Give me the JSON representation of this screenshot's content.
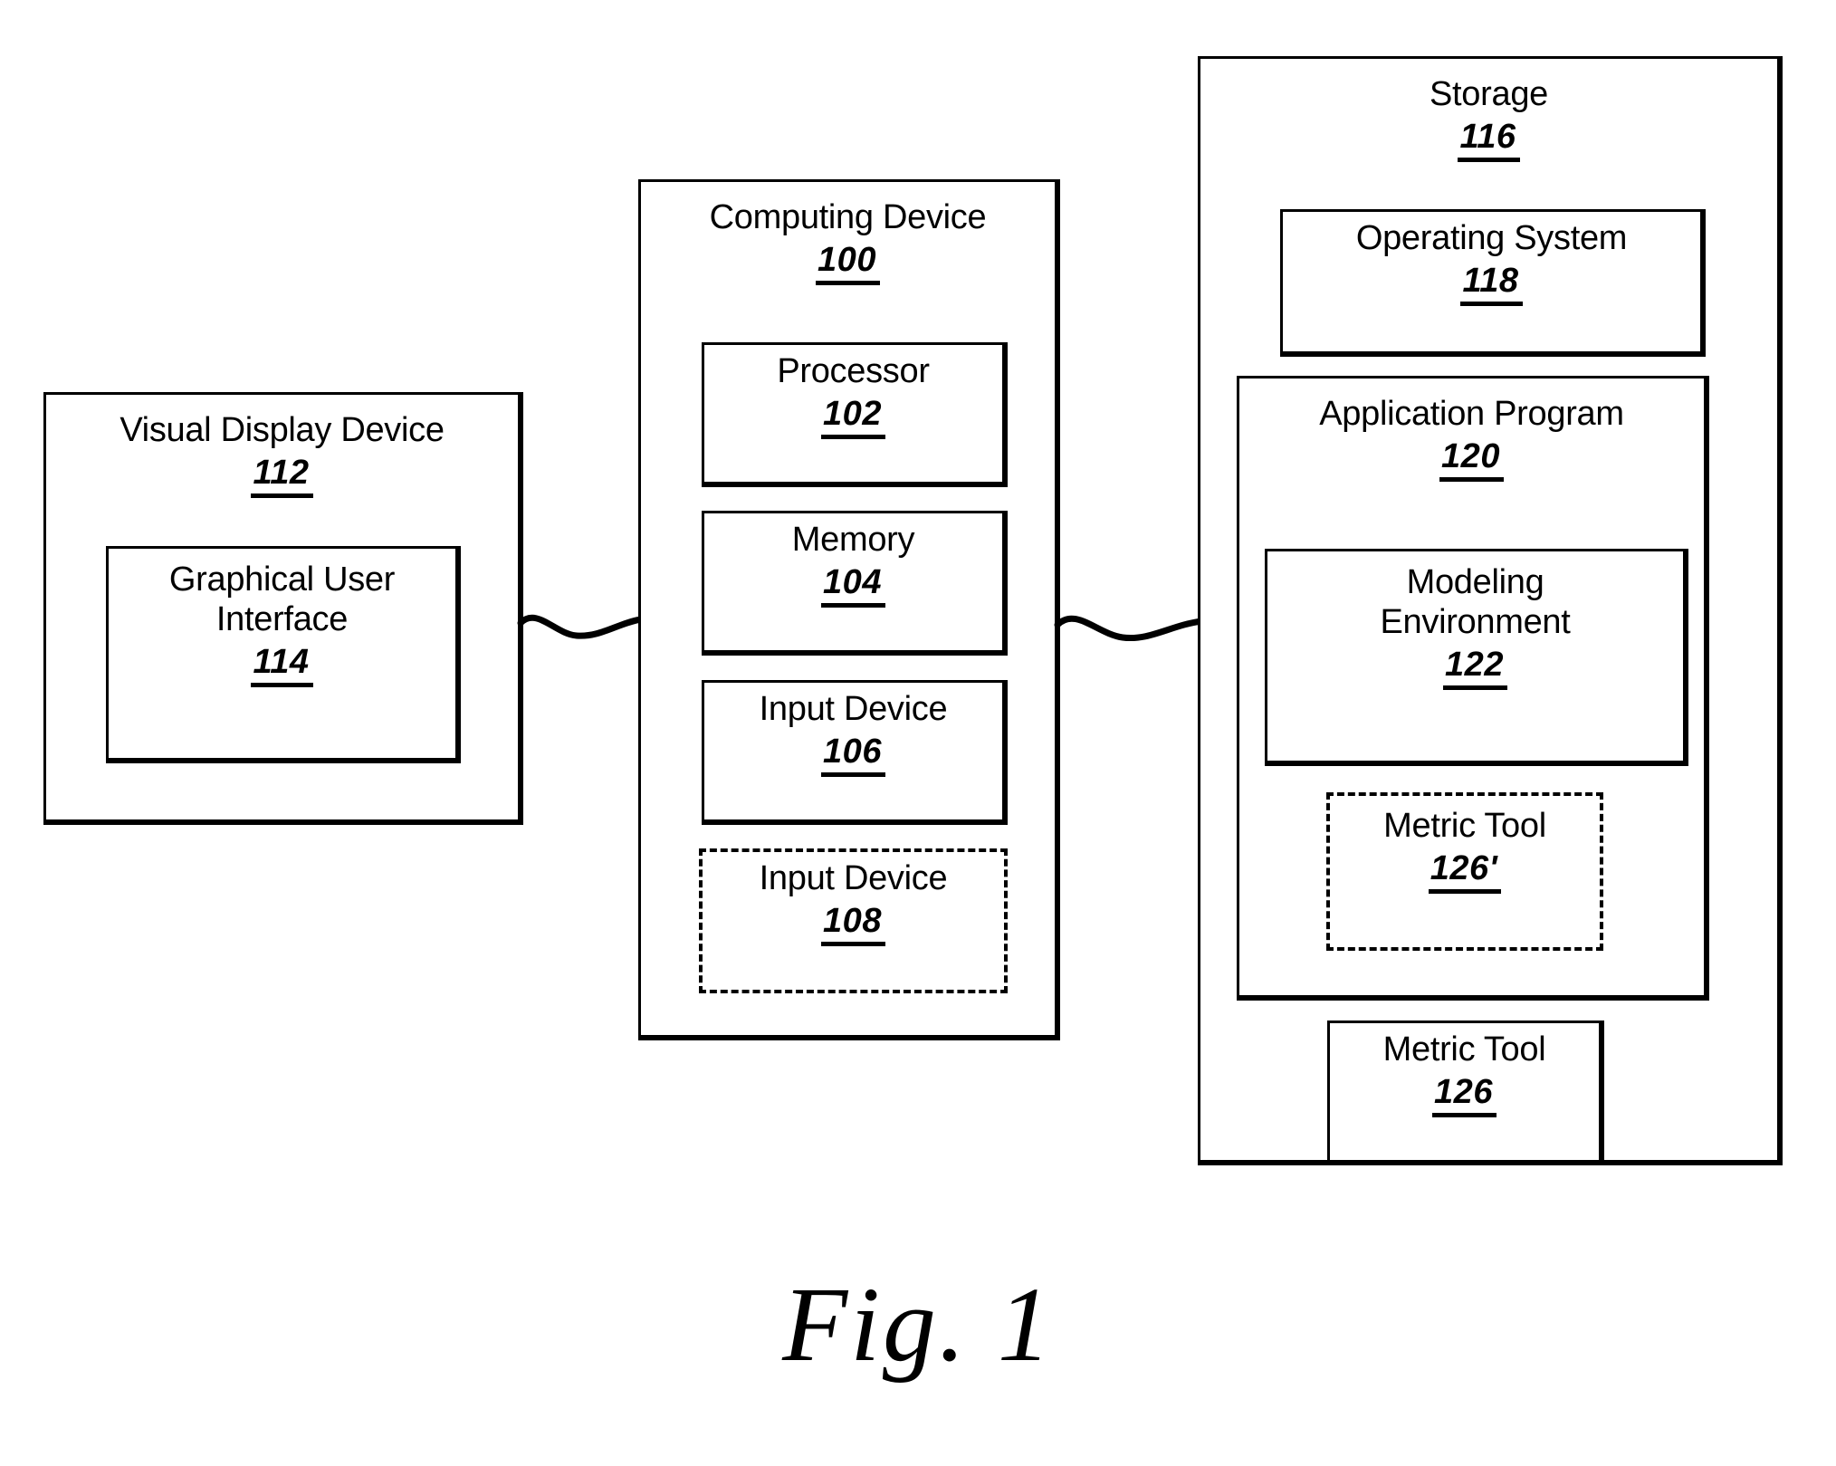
{
  "figure": {
    "caption": "Fig. 1"
  },
  "blocks": {
    "visual_display_device": {
      "label": "Visual Display Device",
      "ref": "112"
    },
    "graphical_user_interface": {
      "label": "Graphical User\nInterface",
      "ref": "114"
    },
    "computing_device": {
      "label": "Computing Device",
      "ref": "100"
    },
    "processor": {
      "label": "Processor",
      "ref": "102"
    },
    "memory": {
      "label": "Memory",
      "ref": "104"
    },
    "input_device_106": {
      "label": "Input Device",
      "ref": "106"
    },
    "input_device_108": {
      "label": "Input Device",
      "ref": "108"
    },
    "storage": {
      "label": "Storage",
      "ref": "116"
    },
    "operating_system": {
      "label": "Operating System",
      "ref": "118"
    },
    "application_program": {
      "label": "Application Program",
      "ref": "120"
    },
    "modeling_environment": {
      "label": "Modeling\nEnvironment",
      "ref": "122"
    },
    "metric_tool_126_prime": {
      "label": "Metric Tool",
      "ref": "126'"
    },
    "metric_tool_126": {
      "label": "Metric Tool",
      "ref": "126"
    }
  },
  "connectors": {
    "display_to_computing": "wavy-line",
    "computing_to_storage": "wavy-line"
  },
  "colors": {
    "stroke": "#000000",
    "background": "#ffffff"
  }
}
